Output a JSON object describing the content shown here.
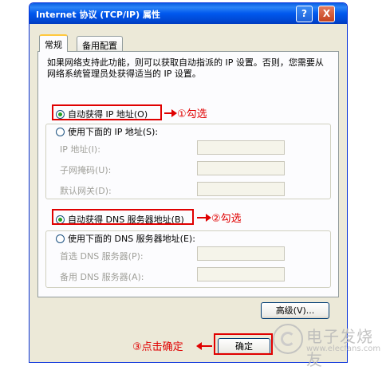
{
  "window": {
    "title": "Internet 协议 (TCP/IP) 属性",
    "help_btn": "?",
    "close_btn": "X"
  },
  "tabs": [
    {
      "label": "常规"
    },
    {
      "label": "备用配置"
    }
  ],
  "description": "如果网络支持此功能，则可以获取自动指派的 IP 设置。否则，您需要从网络系统管理员处获得适当的 IP 设置。",
  "ip_section": {
    "auto_label": "自动获得 IP 地址(O)",
    "auto_selected": true,
    "manual_label": "使用下面的 IP 地址(S):",
    "fields": [
      {
        "label": "IP 地址(I):"
      },
      {
        "label": "子网掩码(U):"
      },
      {
        "label": "默认网关(D):"
      }
    ]
  },
  "dns_section": {
    "auto_label": "自动获得 DNS 服务器地址(B)",
    "auto_selected": true,
    "manual_label": "使用下面的 DNS 服务器地址(E):",
    "fields": [
      {
        "label": "首选 DNS 服务器(P):"
      },
      {
        "label": "备用 DNS 服务器(A):"
      }
    ]
  },
  "buttons": {
    "advanced": "高级(V)...",
    "ok": "确定"
  },
  "annotations": {
    "step1": "①勾选",
    "step2": "②勾选",
    "step3": "③点击确定"
  },
  "watermark": {
    "cn": "电子发烧友",
    "en": "www.elecfans.com"
  },
  "colors": {
    "annotation_red": "#e00000",
    "titlebar_blue": "#0058ee"
  }
}
